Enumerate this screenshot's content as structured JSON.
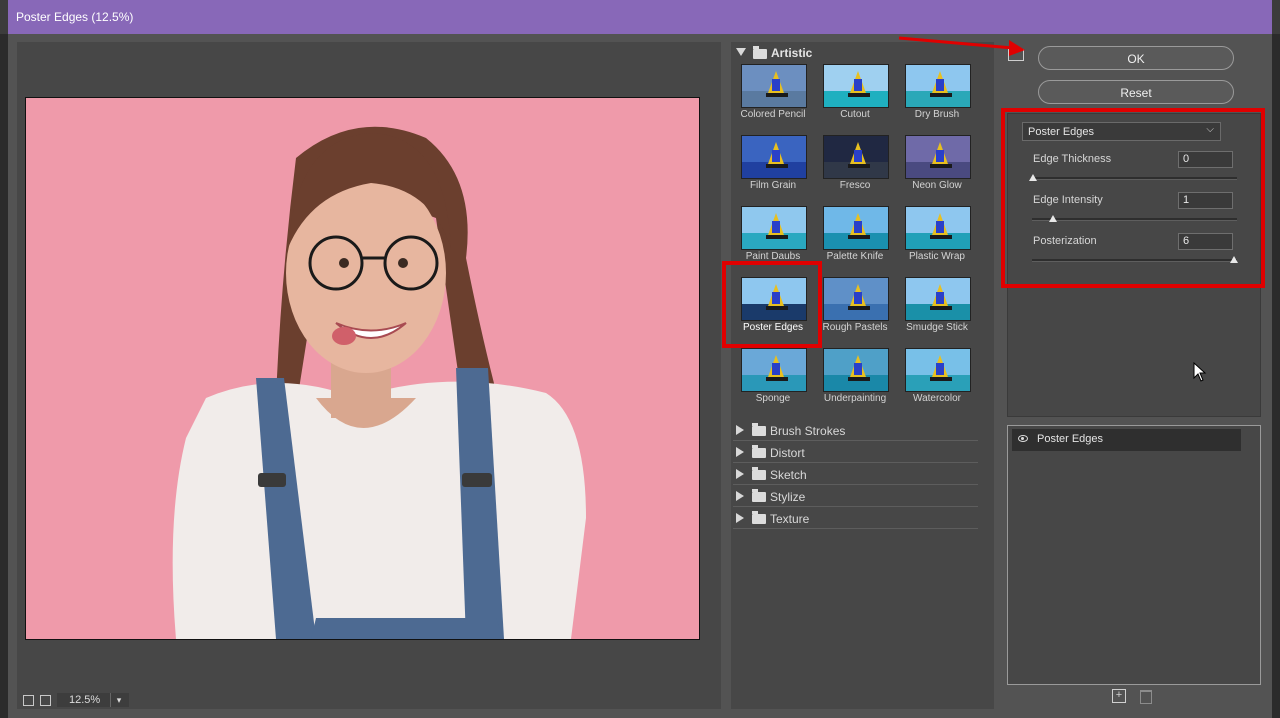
{
  "window": {
    "title": "Poster Edges (12.5%)"
  },
  "preview": {
    "zoom": "12.5%"
  },
  "gallery": {
    "open_category": "Artistic",
    "filters": [
      {
        "label": "Colored Pencil"
      },
      {
        "label": "Cutout"
      },
      {
        "label": "Dry Brush"
      },
      {
        "label": "Film Grain"
      },
      {
        "label": "Fresco"
      },
      {
        "label": "Neon Glow"
      },
      {
        "label": "Paint Daubs"
      },
      {
        "label": "Palette Knife"
      },
      {
        "label": "Plastic Wrap"
      },
      {
        "label": "Poster Edges",
        "selected": true
      },
      {
        "label": "Rough Pastels"
      },
      {
        "label": "Smudge Stick"
      },
      {
        "label": "Sponge"
      },
      {
        "label": "Underpainting"
      },
      {
        "label": "Watercolor"
      }
    ],
    "collapsed_categories": [
      "Brush Strokes",
      "Distort",
      "Sketch",
      "Stylize",
      "Texture"
    ]
  },
  "actions": {
    "ok": "OK",
    "reset": "Reset"
  },
  "settings": {
    "filter": "Poster Edges",
    "params": [
      {
        "label": "Edge Thickness",
        "value": "0"
      },
      {
        "label": "Edge Intensity",
        "value": "1"
      },
      {
        "label": "Posterization",
        "value": "6"
      }
    ]
  },
  "layers": {
    "items": [
      {
        "label": "Poster Edges"
      }
    ]
  },
  "colors": {
    "titlebar": "#8868b8",
    "highlight": "#e00000",
    "canvas": "#ef9aaa"
  }
}
